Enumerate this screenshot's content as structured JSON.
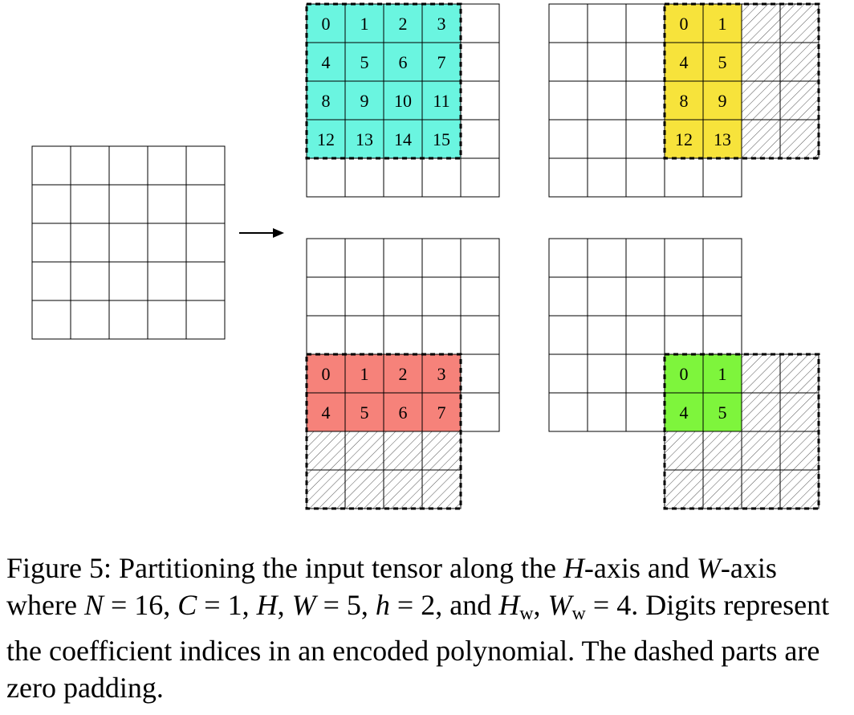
{
  "figure": {
    "panels": [
      {
        "name": "top-left",
        "color": "#6af5e0",
        "hatch_rows": [],
        "hatch_cols": [],
        "labels": [
          [
            "0",
            "1",
            "2",
            "3"
          ],
          [
            "4",
            "5",
            "6",
            "7"
          ],
          [
            "8",
            "9",
            "10",
            "11"
          ],
          [
            "12",
            "13",
            "14",
            "15"
          ]
        ]
      },
      {
        "name": "top-right",
        "color": "#f7e33b",
        "hatch_rows": [],
        "hatch_cols": [
          2,
          3
        ],
        "labels": [
          [
            "0",
            "1"
          ],
          [
            "4",
            "5"
          ],
          [
            "8",
            "9"
          ],
          [
            "12",
            "13"
          ]
        ]
      },
      {
        "name": "bottom-left",
        "color": "#f6827a",
        "hatch_rows": [
          2,
          3
        ],
        "hatch_cols": [],
        "labels": [
          [
            "0",
            "1",
            "2",
            "3"
          ],
          [
            "4",
            "5",
            "6",
            "7"
          ]
        ]
      },
      {
        "name": "bottom-right",
        "color": "#7ef53c",
        "hatch_rows": [
          2,
          3
        ],
        "hatch_cols": [
          2,
          3
        ],
        "labels": [
          [
            "0",
            "1"
          ],
          [
            "4",
            "5"
          ]
        ]
      }
    ]
  },
  "caption": {
    "label": "Figure 5:",
    "t1": " Partitioning the input tensor along the ",
    "H": "H",
    "t2": "-axis and ",
    "W": "W",
    "t3": "-axis where ",
    "N": "N",
    "eq1": " = 16, ",
    "C": "C",
    "eq2": " = 1, ",
    "H2": "H",
    "comma1": ", ",
    "W2": "W",
    "eq3": " = 5, ",
    "h": "h",
    "eq4": " = 2, and ",
    "Hw": "H",
    "Hw_sub": "w",
    "comma2": ", ",
    "Ww": "W",
    "Ww_sub": "w",
    "eq5": " = 4.",
    "line3": " Digits represent the coefficient indices in an encoded polynomial. The dashed parts are zero padding."
  }
}
